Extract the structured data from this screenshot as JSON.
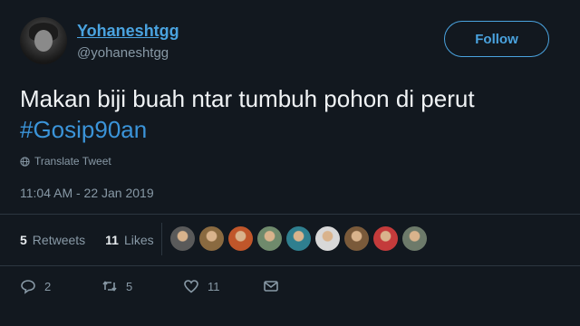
{
  "user": {
    "display_name": "Yohaneshtgg",
    "handle": "@yohaneshtgg"
  },
  "follow_label": "Follow",
  "tweet": {
    "text": "Makan biji buah ntar tumbuh pohon di perut",
    "hashtag": "#Gosip90an"
  },
  "translate_label": "Translate Tweet",
  "timestamp": "11:04 AM - 22 Jan 2019",
  "stats": {
    "retweets_count": "5",
    "retweets_label": "Retweets",
    "likes_count": "11",
    "likes_label": "Likes"
  },
  "liker_avatars": [
    {
      "name": "liker-avatar-1",
      "color": "#5a5a5a"
    },
    {
      "name": "liker-avatar-2",
      "color": "#8a6a40"
    },
    {
      "name": "liker-avatar-3",
      "color": "#c0562a"
    },
    {
      "name": "liker-avatar-4",
      "color": "#6f8a6c"
    },
    {
      "name": "liker-avatar-5",
      "color": "#2f7f8f"
    },
    {
      "name": "liker-avatar-6",
      "color": "#d8d8d8"
    },
    {
      "name": "liker-avatar-7",
      "color": "#7a5a3a"
    },
    {
      "name": "liker-avatar-8",
      "color": "#c43b3b"
    },
    {
      "name": "liker-avatar-9",
      "color": "#6d7a6a"
    }
  ],
  "actions": {
    "reply_count": "2",
    "retweet_count": "5",
    "like_count": "11"
  },
  "colors": {
    "background": "#12181f",
    "accent": "#4aa3df",
    "muted": "#8899a6"
  }
}
